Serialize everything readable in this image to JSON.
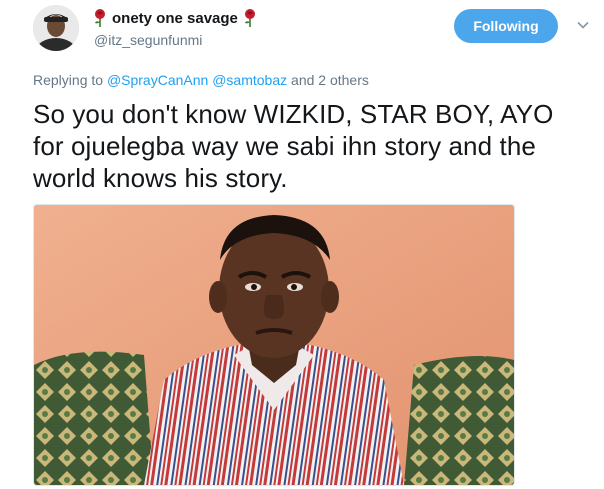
{
  "tweet": {
    "author": {
      "display_name": "onety one savage",
      "handle": "@itz_segunfunmi",
      "avatar_icon": "user-avatar-photo",
      "name_emoji": "rose-icon"
    },
    "follow_button": {
      "label": "Following",
      "color": "#4ba6ec"
    },
    "menu_icon": "chevron-down-icon",
    "replying_to": {
      "prefix": "Replying to",
      "mentions": [
        "@SprayCanAnn",
        "@samtobaz"
      ],
      "suffix": "and 2 others"
    },
    "text_lines": [
      "So you don't know WIZKID, STAR BOY, AYO",
      "for ojuelegba way we sabi ihn story and the",
      "world knows  his story."
    ],
    "media": {
      "type": "photo"
    }
  },
  "colors": {
    "link": "#1da1f2",
    "secondary_text": "#657786",
    "primary_text": "#14171a"
  }
}
